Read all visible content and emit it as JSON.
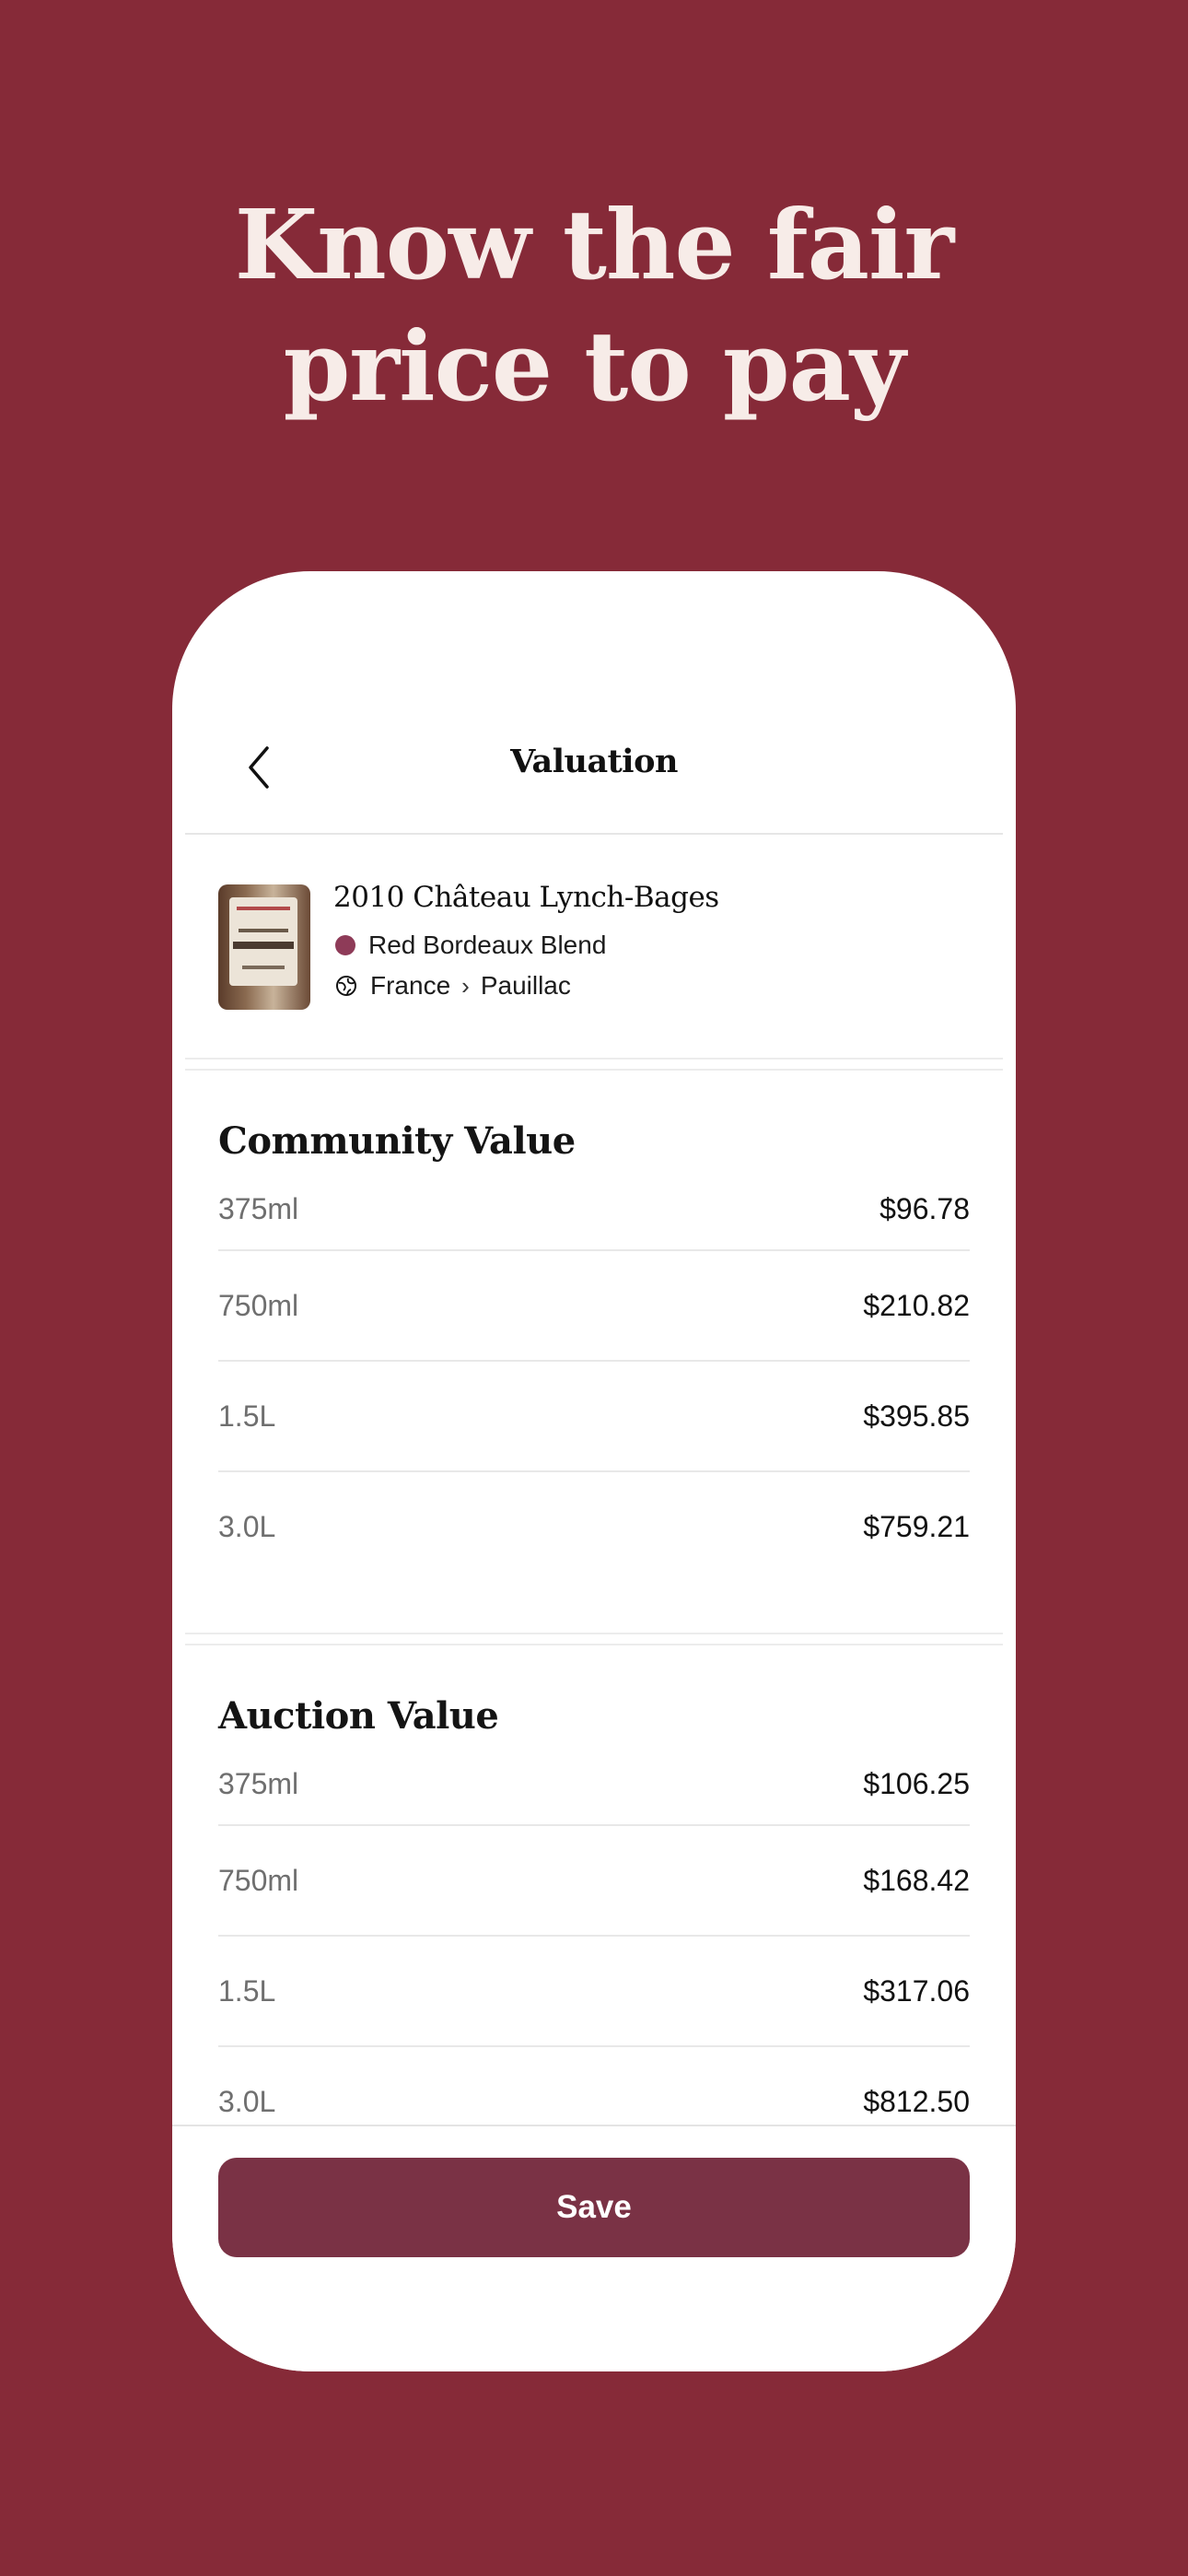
{
  "headline": {
    "line1": "Know the fair",
    "line2": "price to pay"
  },
  "nav": {
    "title": "Valuation",
    "back_icon": "chevron-left-icon"
  },
  "wine": {
    "name": "2010 Château Lynch-Bages",
    "type": "Red Bordeaux Blend",
    "type_color": "#8e3b58",
    "country": "France",
    "region": "Pauillac"
  },
  "community": {
    "title": "Community Value",
    "rows": [
      {
        "size": "375ml",
        "price": "$96.78"
      },
      {
        "size": "750ml",
        "price": "$210.82"
      },
      {
        "size": "1.5L",
        "price": "$395.85"
      },
      {
        "size": "3.0L",
        "price": "$759.21"
      }
    ]
  },
  "auction": {
    "title": "Auction Value",
    "rows": [
      {
        "size": "375ml",
        "price": "$106.25"
      },
      {
        "size": "750ml",
        "price": "$168.42"
      },
      {
        "size": "1.5L",
        "price": "$317.06"
      },
      {
        "size": "3.0L",
        "price": "$812.50"
      }
    ]
  },
  "footer": {
    "save_label": "Save"
  },
  "colors": {
    "background": "#862a38",
    "button": "#7a3245"
  }
}
